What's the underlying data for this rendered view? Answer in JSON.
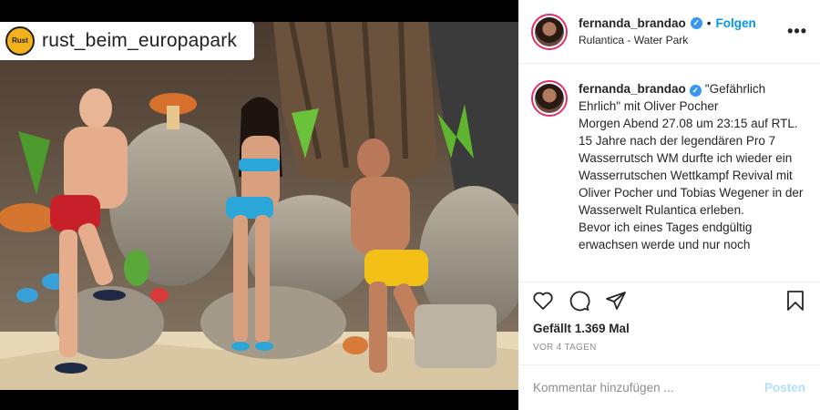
{
  "media": {
    "watermark_logo_text": "Rust",
    "watermark_handle": "rust_beim_europapark"
  },
  "header": {
    "username": "fernanda_brandao",
    "verified_icon": "verified-badge-icon",
    "separator": "•",
    "follow_label": "Folgen",
    "location": "Rulantica - Water Park",
    "more_icon": "more-options-icon"
  },
  "caption": {
    "username": "fernanda_brandao",
    "lines": [
      "\"Gefährlich Ehrlich\" mit Oliver Pocher",
      "Morgen Abend 27.08 um 23:15 auf RTL.",
      "15 Jahre nach der legendären Pro 7 Wasserrutsch WM durfte ich wieder ein Wasserrutschen Wettkampf Revival mit Oliver Pocher und Tobias Wegener in der Wasserwelt Rulantica erleben.",
      "Bevor ich eines Tages endgültig erwachsen werde und nur noch"
    ]
  },
  "actions": {
    "like_icon": "heart-icon",
    "comment_icon": "comment-icon",
    "share_icon": "share-icon",
    "save_icon": "bookmark-icon"
  },
  "likes": "Gefällt 1.369 Mal",
  "date": "VOR 4 TAGEN",
  "comment": {
    "placeholder": "Kommentar hinzufügen ...",
    "post_label": "Posten"
  },
  "colors": {
    "accent": "#0095f6",
    "post_disabled": "#b2dffc",
    "muted": "#8e8e8e"
  }
}
